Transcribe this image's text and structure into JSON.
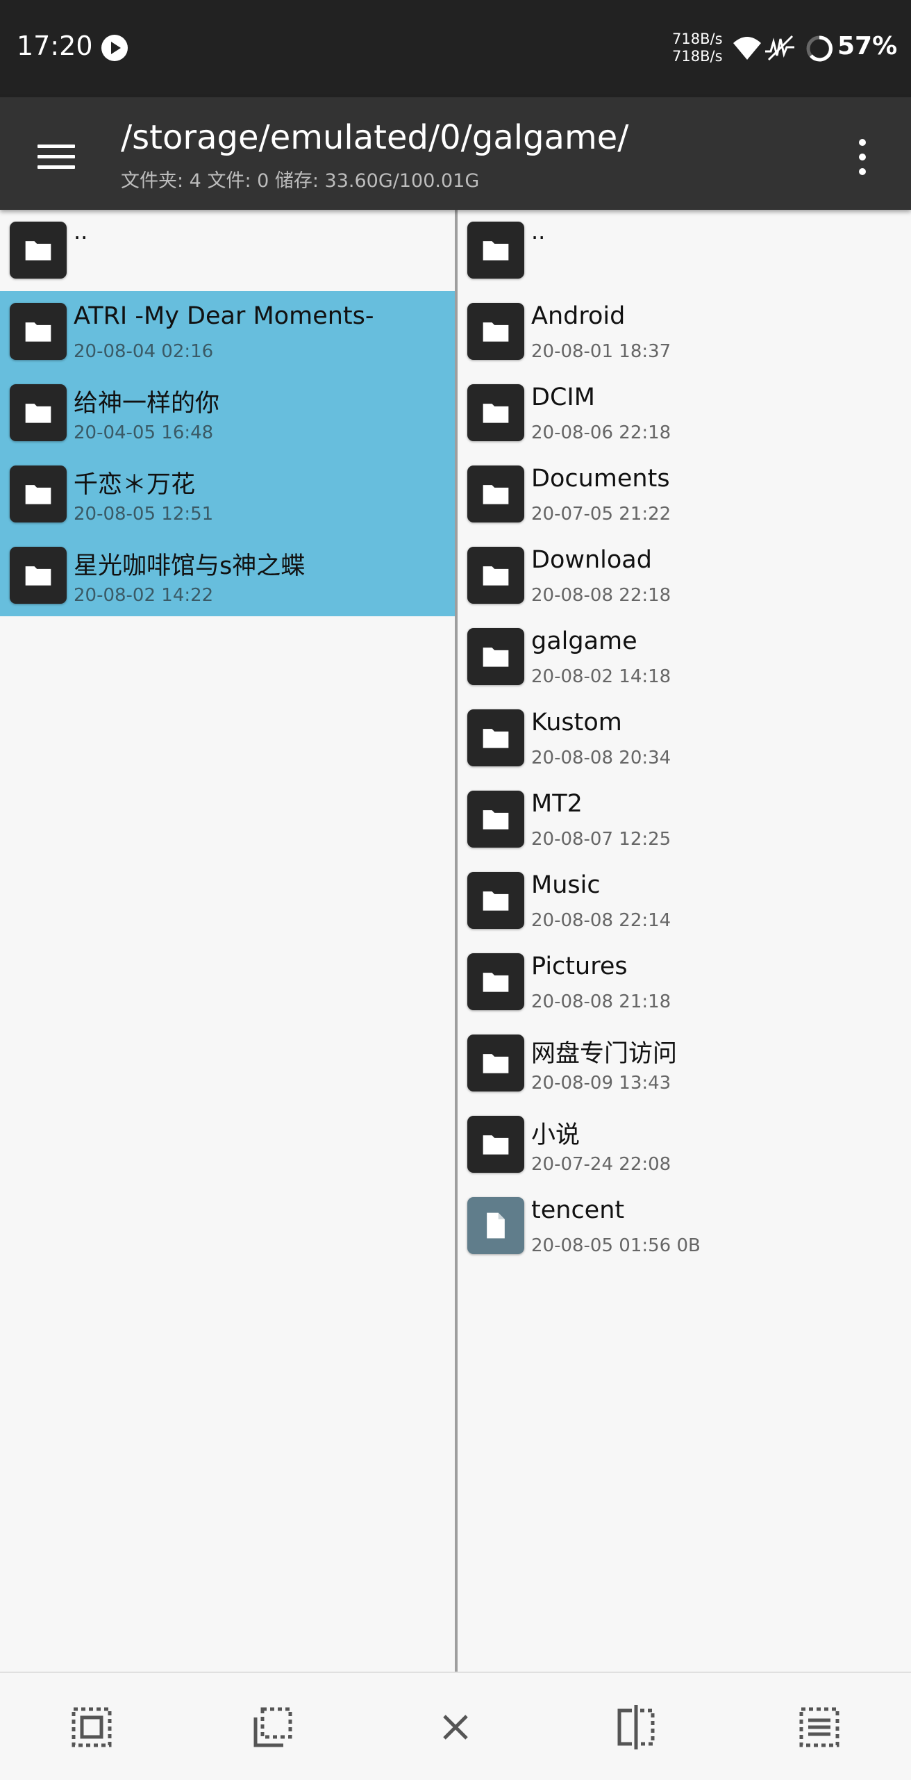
{
  "status_bar": {
    "time": "17:20",
    "net_up": "718B/s",
    "net_down": "718B/s",
    "battery": "57%",
    "icons": [
      "play-icon",
      "wifi-icon",
      "signal-icon",
      "battery-ring-icon"
    ]
  },
  "app_bar": {
    "path": "/storage/emulated/0/galgame/",
    "info": "文件夹: 4  文件: 0  储存: 33.60G/100.01G",
    "icons": [
      "hamburger-menu-icon",
      "more-vert-icon"
    ]
  },
  "left_pane": {
    "items": [
      {
        "name": "..",
        "date": "",
        "type": "folder",
        "selected": false
      },
      {
        "name": "ATRI -My Dear Moments-",
        "date": "20-08-04 02:16",
        "type": "folder",
        "selected": true
      },
      {
        "name": "给神一样的你",
        "date": "20-04-05 16:48",
        "type": "folder",
        "selected": true
      },
      {
        "name": "千恋＊万花",
        "date": "20-08-05 12:51",
        "type": "folder",
        "selected": true
      },
      {
        "name": "星光咖啡馆与s神之蝶",
        "date": "20-08-02 14:22",
        "type": "folder",
        "selected": true
      }
    ]
  },
  "right_pane": {
    "items": [
      {
        "name": "..",
        "date": "",
        "type": "folder"
      },
      {
        "name": "Android",
        "date": "20-08-01 18:37",
        "type": "folder"
      },
      {
        "name": "DCIM",
        "date": "20-08-06 22:18",
        "type": "folder"
      },
      {
        "name": "Documents",
        "date": "20-07-05 21:22",
        "type": "folder"
      },
      {
        "name": "Download",
        "date": "20-08-08 22:18",
        "type": "folder"
      },
      {
        "name": "galgame",
        "date": "20-08-02 14:18",
        "type": "folder"
      },
      {
        "name": "Kustom",
        "date": "20-08-08 20:34",
        "type": "folder"
      },
      {
        "name": "MT2",
        "date": "20-08-07 12:25",
        "type": "folder"
      },
      {
        "name": "Music",
        "date": "20-08-08 22:14",
        "type": "folder"
      },
      {
        "name": "Pictures",
        "date": "20-08-08 21:18",
        "type": "folder"
      },
      {
        "name": "网盘专门访问",
        "date": "20-08-09 13:43",
        "type": "folder"
      },
      {
        "name": "小说",
        "date": "20-07-24 22:08",
        "type": "folder"
      },
      {
        "name": "tencent",
        "date": "20-08-05 01:56   0B",
        "type": "file"
      }
    ]
  },
  "bottom_bar": {
    "buttons": [
      "select-all-icon",
      "copy-selection-icon",
      "close-icon",
      "split-view-icon",
      "list-view-icon"
    ]
  },
  "colors": {
    "status_bar_bg": "#222222",
    "app_bar_bg": "#333333",
    "selection": "#67bedd",
    "folder_icon_bg": "#262626",
    "file_icon_bg": "#607d8b"
  }
}
